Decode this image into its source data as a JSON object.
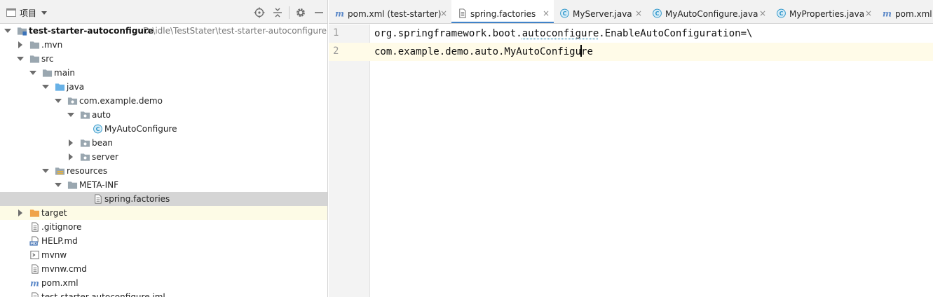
{
  "project_panel": {
    "title": "项目",
    "toolbar": [
      "locate-icon",
      "collapse-icon",
      "gear-icon",
      "minimize-icon"
    ]
  },
  "tree": [
    {
      "label": "test-starter-autoconfigure",
      "path": "D:\\idle\\TestStater\\test-starter-autoconfigure",
      "icon": "module-folder-icon",
      "expanded": true,
      "bold": true
    },
    {
      "label": ".mvn",
      "icon": "folder-icon",
      "expanded": false
    },
    {
      "label": "src",
      "icon": "folder-icon",
      "expanded": true
    },
    {
      "label": "main",
      "icon": "folder-icon",
      "expanded": true
    },
    {
      "label": "java",
      "icon": "source-folder-icon",
      "expanded": true
    },
    {
      "label": "com.example.demo",
      "icon": "package-icon",
      "expanded": true
    },
    {
      "label": "auto",
      "icon": "package-icon",
      "expanded": true
    },
    {
      "label": "MyAutoConfigure",
      "icon": "java-class-icon"
    },
    {
      "label": "bean",
      "icon": "package-icon",
      "expanded": false
    },
    {
      "label": "server",
      "icon": "package-icon",
      "expanded": false
    },
    {
      "label": "resources",
      "icon": "resources-folder-icon",
      "expanded": true
    },
    {
      "label": "META-INF",
      "icon": "folder-icon",
      "expanded": true
    },
    {
      "label": "spring.factories",
      "icon": "text-file-icon",
      "selected": true
    },
    {
      "label": "target",
      "icon": "excluded-folder-icon",
      "expanded": false
    },
    {
      "label": ".gitignore",
      "icon": "text-file-icon"
    },
    {
      "label": "HELP.md",
      "icon": "markdown-file-icon"
    },
    {
      "label": "mvnw",
      "icon": "script-file-icon"
    },
    {
      "label": "mvnw.cmd",
      "icon": "text-file-icon"
    },
    {
      "label": "pom.xml",
      "icon": "maven-icon"
    },
    {
      "label": "test-starter-autoconfigure.iml",
      "icon": "text-file-icon"
    }
  ],
  "tabs": [
    {
      "label": "pom.xml (test-starter)",
      "icon": "maven-icon",
      "active": false
    },
    {
      "label": "spring.factories",
      "icon": "text-file-icon",
      "active": true
    },
    {
      "label": "MyServer.java",
      "icon": "java-class-icon",
      "active": false
    },
    {
      "label": "MyAutoConfigure.java",
      "icon": "java-class-icon",
      "active": false
    },
    {
      "label": "MyProperties.java",
      "icon": "java-class-icon",
      "active": false
    },
    {
      "label": "pom.xml",
      "icon": "maven-icon",
      "active": false
    }
  ],
  "tab_close_glyph": "×",
  "editor": {
    "line_numbers": [
      "1",
      "2"
    ],
    "lines": [
      "org.springframework.boot.autoconfigure.EnableAutoConfiguration=\\",
      "com.example.demo.auto.MyAutoConfigure"
    ],
    "caret": {
      "line": 2,
      "column": 35
    }
  },
  "colors": {
    "selection": "#d5d5d5",
    "excluded_row": "#fdfbe6",
    "active_tab_underline": "#4083c9",
    "java_class": "#2c95c9",
    "folder": "#9aa7b0",
    "source_folder": "#68b1e6",
    "excluded_folder": "#f0a34a",
    "maven": "#5b88c8",
    "current_line": "#fffbe8"
  }
}
